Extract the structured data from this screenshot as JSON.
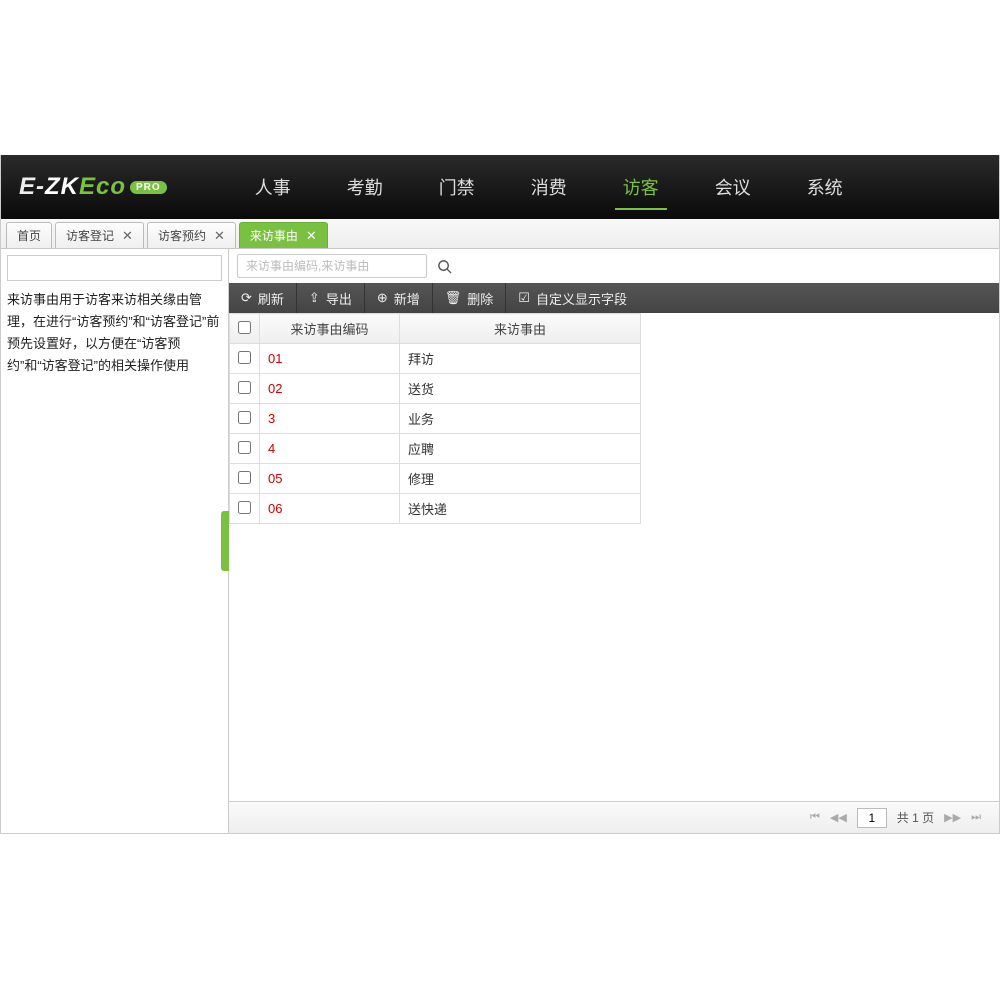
{
  "logo": {
    "e": "E-",
    "zk": "ZK",
    "eco": "Eco",
    "badge": "PRO"
  },
  "nav": [
    {
      "label": "人事",
      "active": false
    },
    {
      "label": "考勤",
      "active": false
    },
    {
      "label": "门禁",
      "active": false
    },
    {
      "label": "消费",
      "active": false
    },
    {
      "label": "访客",
      "active": true
    },
    {
      "label": "会议",
      "active": false
    },
    {
      "label": "系统",
      "active": false
    }
  ],
  "tabs": [
    {
      "label": "首页",
      "closable": false,
      "active": false
    },
    {
      "label": "访客登记",
      "closable": true,
      "active": false
    },
    {
      "label": "访客预约",
      "closable": true,
      "active": false
    },
    {
      "label": "来访事由",
      "closable": true,
      "active": true
    }
  ],
  "sidebar_text": "来访事由用于访客来访相关缘由管理，在进行“访客预约”和“访客登记”前预先设置好，以方便在“访客预约”和“访客登记”的相关操作使用",
  "search": {
    "placeholder": "来访事由编码,来访事由"
  },
  "toolbar": {
    "refresh": "刷新",
    "export": "导出",
    "add": "新增",
    "delete": "删除",
    "custom": "自定义显示字段"
  },
  "table": {
    "cols": {
      "code": "来访事由编码",
      "reason": "来访事由"
    },
    "rows": [
      {
        "code": "01",
        "reason": "拜访"
      },
      {
        "code": "02",
        "reason": "送货"
      },
      {
        "code": "3",
        "reason": "业务"
      },
      {
        "code": "4",
        "reason": "应聘"
      },
      {
        "code": "05",
        "reason": "修理"
      },
      {
        "code": "06",
        "reason": "送快递"
      }
    ]
  },
  "pager": {
    "current": "1",
    "total_prefix": "共 ",
    "total_n": "1",
    "total_suffix": " 页"
  }
}
